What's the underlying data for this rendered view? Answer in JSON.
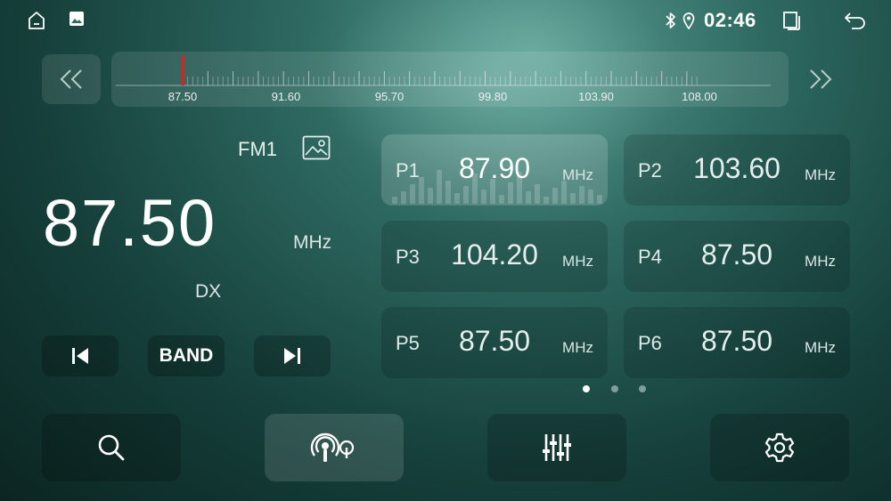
{
  "status_bar": {
    "time": "02:46",
    "icons": [
      "home-icon",
      "gallery-icon",
      "bluetooth-icon",
      "location-icon",
      "recent-apps-icon",
      "back-icon"
    ]
  },
  "tuner": {
    "scale_labels": [
      "87.50",
      "91.60",
      "95.70",
      "99.80",
      "103.90",
      "108.00"
    ],
    "scale_min": 87.5,
    "scale_max": 108.0,
    "needle_freq": 87.5,
    "needle_color": "#e02020"
  },
  "current": {
    "band": "FM1",
    "frequency": "87.50",
    "unit": "MHz",
    "dx": "DX"
  },
  "controls": {
    "band_label": "BAND"
  },
  "presets": [
    {
      "label": "P1",
      "freq": "87.90",
      "unit": "MHz",
      "active": true
    },
    {
      "label": "P2",
      "freq": "103.60",
      "unit": "MHz",
      "active": false
    },
    {
      "label": "P3",
      "freq": "104.20",
      "unit": "MHz",
      "active": false
    },
    {
      "label": "P4",
      "freq": "87.50",
      "unit": "MHz",
      "active": false
    },
    {
      "label": "P5",
      "freq": "87.50",
      "unit": "MHz",
      "active": false
    },
    {
      "label": "P6",
      "freq": "87.50",
      "unit": "MHz",
      "active": false
    }
  ],
  "pagination": {
    "pages": 3,
    "current": 1
  },
  "bottom_bar": [
    "search-icon",
    "radio-broadcast-icon",
    "equalizer-icon",
    "settings-icon"
  ]
}
